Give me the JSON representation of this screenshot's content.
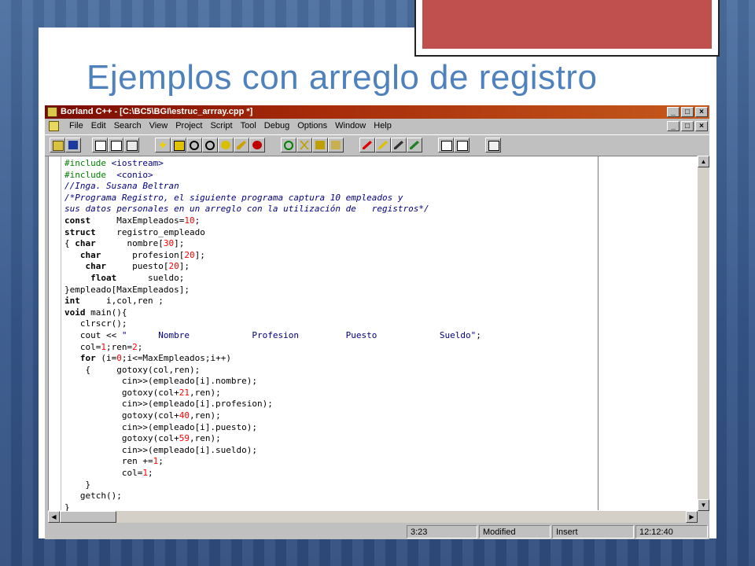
{
  "slide": {
    "title": "Ejemplos con arreglo de registro"
  },
  "window": {
    "title": "Borland C++ - [C:\\BC5\\BGI\\estruc_arrray.cpp *]",
    "controls": [
      "_",
      "□",
      "×"
    ]
  },
  "menu": {
    "items": [
      "File",
      "Edit",
      "Search",
      "View",
      "Project",
      "Script",
      "Tool",
      "Debug",
      "Options",
      "Window",
      "Help"
    ]
  },
  "toolbar": {
    "icons": [
      "open-file-icon",
      "save-icon",
      "new-file-icon",
      "project-icon",
      "copy-icon",
      "lightning-icon",
      "build-icon",
      "find-icon",
      "replace-icon",
      "stop-icon",
      "pen-icon",
      "run-icon",
      "undo-icon",
      "cut-icon",
      "paste-icon",
      "lock-icon",
      "marker-icon",
      "step-icon",
      "breakpoint-icon",
      "inspect-icon",
      "window-icon",
      "split-icon",
      "help-icon"
    ]
  },
  "code": {
    "lines": [
      "#include <iostream>",
      "#include  <conio>",
      "//Inga. Susana Beltran",
      "/*Programa Registro, el siguiente programa captura 10 empleados y",
      "sus datos personales en un arreglo con la utilización de   registros*/",
      "const     MaxEmpleados=10;",
      "struct    registro_empleado",
      "{ char      nombre[30];",
      "   char      profesion[20];",
      "    char     puesto[20];",
      "     float      sueldo;",
      "}empleado[MaxEmpleados];",
      "int     i,col,ren ;",
      "void main(){",
      "   clrscr();",
      "   cout << \"      Nombre            Profesion         Puesto            Sueldo\";",
      "   col=1;ren=2;",
      "   for (i=0;i<=MaxEmpleados;i++)",
      "    {     gotoxy(col,ren);",
      "           cin>>(empleado[i].nombre);",
      "           gotoxy(col+21,ren);",
      "           cin>>(empleado[i].profesion);",
      "           gotoxy(col+40,ren);",
      "           cin>>(empleado[i].puesto);",
      "           gotoxy(col+59,ren);",
      "           cin>>(empleado[i].sueldo);",
      "           ren +=1;",
      "           col=1;",
      "    }",
      "   getch();",
      "}"
    ]
  },
  "status": {
    "position": "3:23",
    "modified": "Modified",
    "mode": "Insert",
    "time": "12:12:40"
  }
}
